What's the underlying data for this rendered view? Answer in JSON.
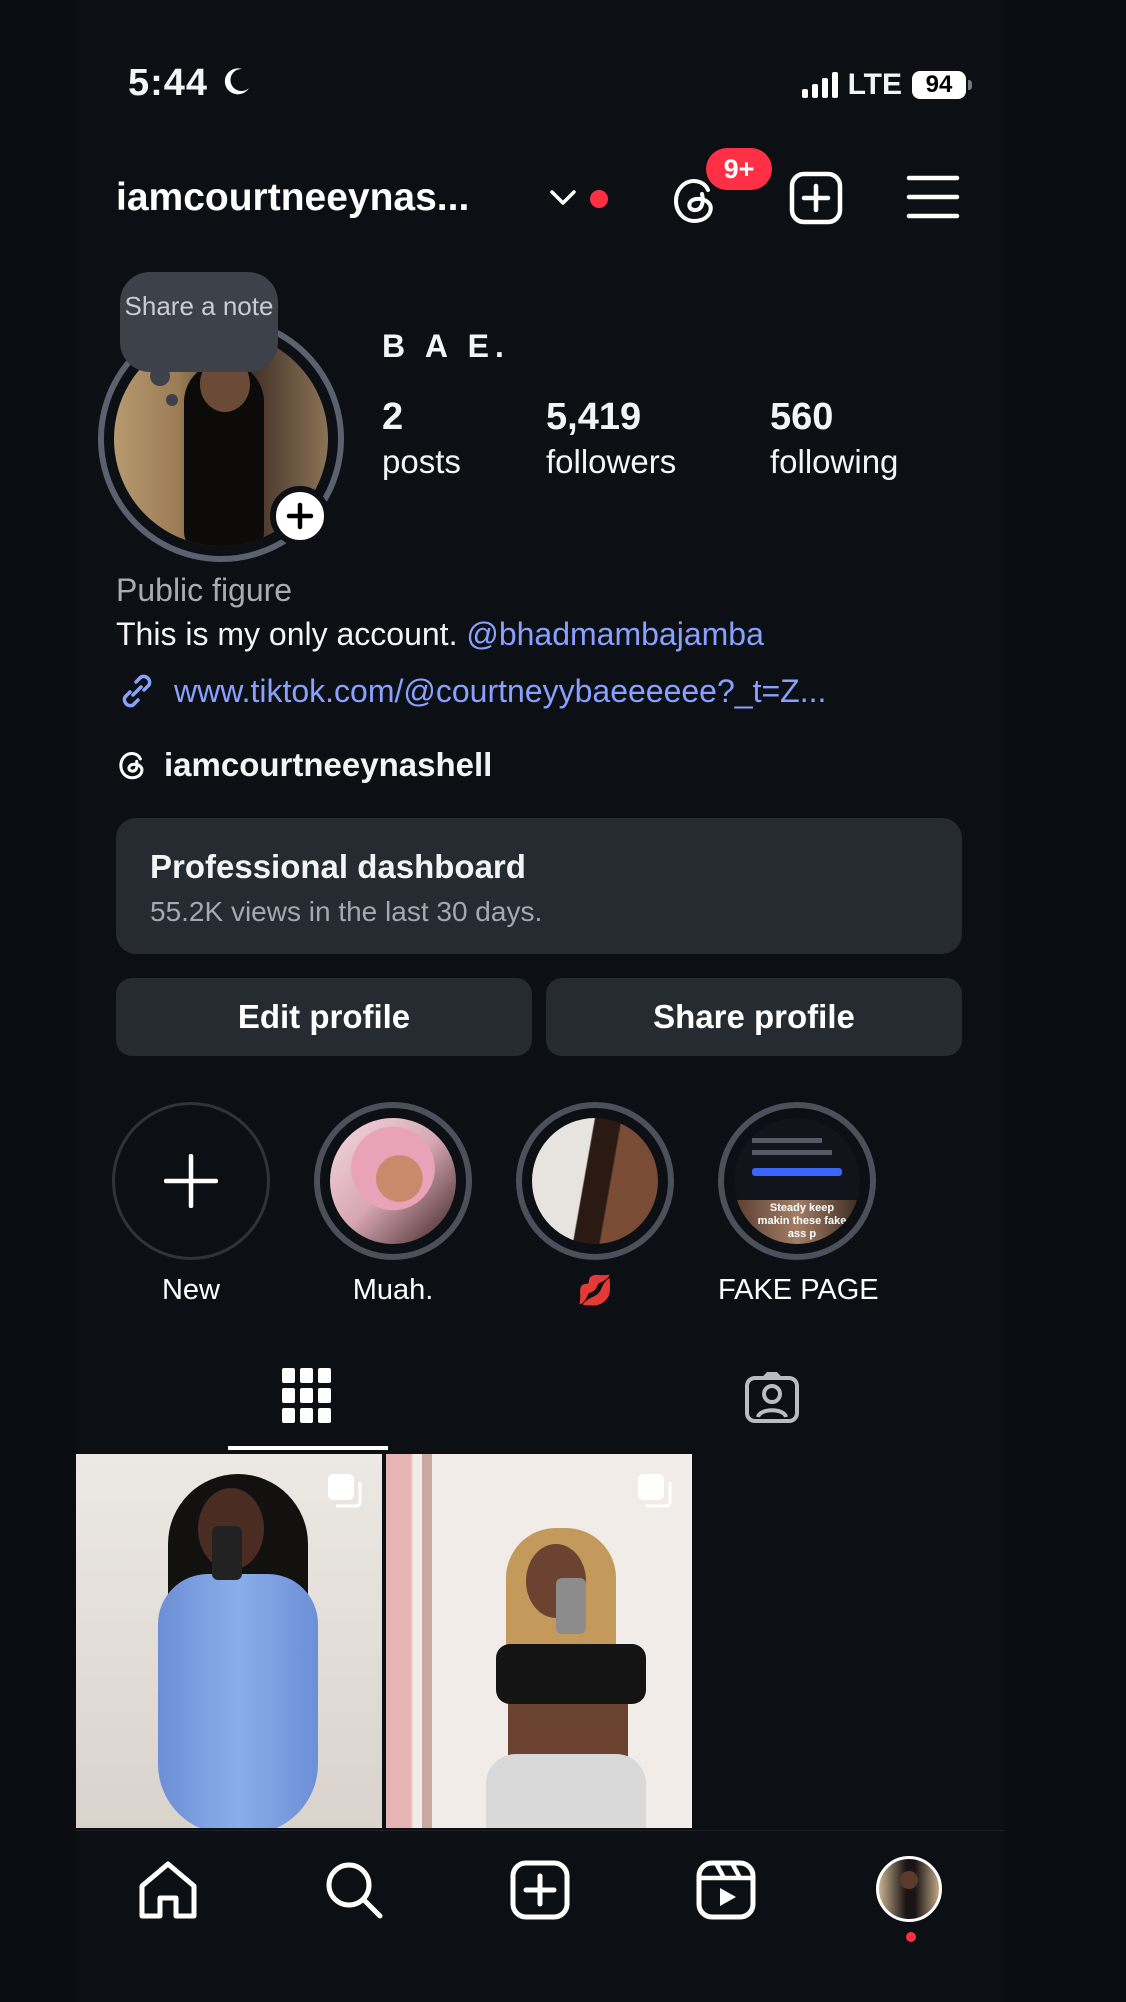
{
  "status_bar": {
    "time": "5:44",
    "network": "LTE",
    "battery": "94"
  },
  "header": {
    "username": "iamcourtneeynas...",
    "notifications_badge": "9+"
  },
  "profile": {
    "note_prompt": "Share a note",
    "display_name": "B A E.",
    "stats": [
      {
        "value": "2",
        "label": "posts"
      },
      {
        "value": "5,419",
        "label": "followers"
      },
      {
        "value": "560",
        "label": "following"
      }
    ],
    "category": "Public figure",
    "bio_text": "This is my only account. ",
    "bio_mention": "@bhadmambajamba",
    "link": "www.tiktok.com/@courtneyybaeeeeee?_t=Z...",
    "threads_handle": "iamcourtneeynashell"
  },
  "dashboard": {
    "title": "Professional dashboard",
    "subtitle": "55.2K views in the last 30 days."
  },
  "buttons": {
    "edit": "Edit profile",
    "share": "Share profile"
  },
  "highlights": [
    {
      "label": "New"
    },
    {
      "label": "Muah."
    },
    {
      "label": "💋"
    },
    {
      "label": "FAKE PAGE"
    }
  ],
  "highlight_fake_page_text": "Steady keep makin these fake ass p",
  "colors": {
    "accent_link": "#8aa0ff",
    "badge_red": "#ff2f45",
    "background": "#0c0f14"
  }
}
